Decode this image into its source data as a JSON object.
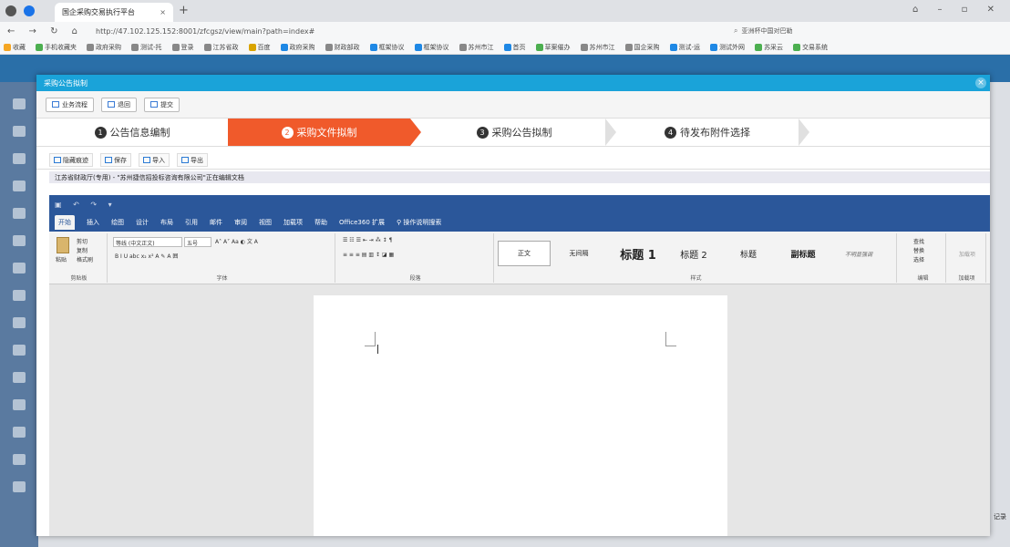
{
  "browser": {
    "tab_title": "国企采购交易执行平台",
    "url": "http://47.102.125.152:8001/zfcgsz/view/main?path=index#",
    "search_text": "亚洲杯中国对巴勒"
  },
  "bookmarks": [
    "收藏",
    "手机收藏夹",
    "政府采购",
    "测试-托",
    "登录",
    "江苏省政",
    "百度",
    "政府采购",
    "财政部政",
    "框架协议",
    "框架协议",
    "苏州市江",
    "首页",
    "草案催办",
    "苏州市江",
    "国企采购",
    "测试-运",
    "测试外网",
    "苏采云",
    "交易系统"
  ],
  "modal": {
    "title": "采购公告拟制",
    "toolbar": [
      "业务流程",
      "退回",
      "提交"
    ]
  },
  "steps": [
    {
      "num": "1",
      "label": "公告信息编制"
    },
    {
      "num": "2",
      "label": "采购文件拟制"
    },
    {
      "num": "3",
      "label": "采购公告拟制"
    },
    {
      "num": "4",
      "label": "待发布附件选择"
    }
  ],
  "doc_toolbar": [
    "隐藏痕迹",
    "保存",
    "导入",
    "导出"
  ],
  "doc_info": "江苏省财政厅(专用) - \"苏州捷信招投标咨询有限公司\"正在编辑文档",
  "word": {
    "tabs": [
      "开始",
      "插入",
      "绘图",
      "设计",
      "布局",
      "引用",
      "邮件",
      "审阅",
      "视图",
      "加载项",
      "帮助",
      "Office360 扩展",
      "操作说明搜索"
    ],
    "clipboard": {
      "cut": "剪切",
      "copy": "复制",
      "paste": "粘贴",
      "format_painter": "格式刷",
      "label": "剪贴板"
    },
    "font": {
      "name": "等线 (中文正文)",
      "size": "五号",
      "label": "字体"
    },
    "paragraph_label": "段落",
    "styles": [
      "正文",
      "无间隔",
      "标题 1",
      "标题 2",
      "标题",
      "副标题",
      "不明显强调"
    ],
    "styles_label": "样式",
    "editing": {
      "find": "查找",
      "replace": "替换",
      "select": "选择",
      "label": "编辑"
    },
    "addins": {
      "btn": "加载项",
      "label": "加载项"
    }
  },
  "right_edge_text": "记录"
}
